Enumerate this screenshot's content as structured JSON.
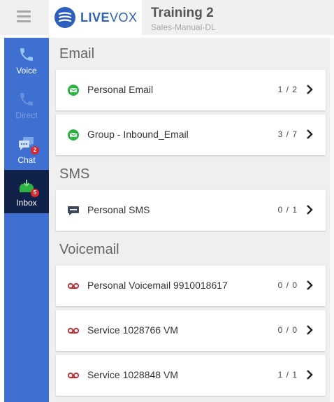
{
  "app": {
    "brand_bold": "LIVE",
    "brand_light": "VOX",
    "title": "Training 2",
    "subtitle": "Sales-Manual-DL"
  },
  "sidebar": {
    "items": [
      {
        "label": "Voice",
        "icon": "phone-icon",
        "state": "normal"
      },
      {
        "label": "Direct",
        "icon": "phone-icon",
        "state": "disabled"
      },
      {
        "label": "Chat",
        "icon": "chat-icon",
        "state": "normal",
        "badge": "2"
      },
      {
        "label": "Inbox",
        "icon": "inbox-icon",
        "state": "active",
        "badge": "5"
      }
    ]
  },
  "sections": {
    "email": {
      "title": "Email",
      "items": [
        {
          "name": "Personal Email",
          "count": "1 / 2"
        },
        {
          "name": "Group - Inbound_Email",
          "count": "3 / 7"
        }
      ]
    },
    "sms": {
      "title": "SMS",
      "items": [
        {
          "name": "Personal SMS",
          "count": "0 / 1"
        }
      ]
    },
    "voicemail": {
      "title": "Voicemail",
      "items": [
        {
          "name": "Personal Voicemail 9910018617",
          "count": "0 / 0"
        },
        {
          "name": "Service 1028766 VM",
          "count": "0 / 0"
        },
        {
          "name": "Service 1028848 VM",
          "count": "1 / 1"
        }
      ]
    }
  },
  "colors": {
    "sidebar": "#3f6fd1",
    "sidebar_active": "#11224a",
    "brand": "#2e5fbd",
    "email_icon": "#2fb344",
    "voicemail_icon": "#c0262b",
    "badge": "#d9262c"
  }
}
